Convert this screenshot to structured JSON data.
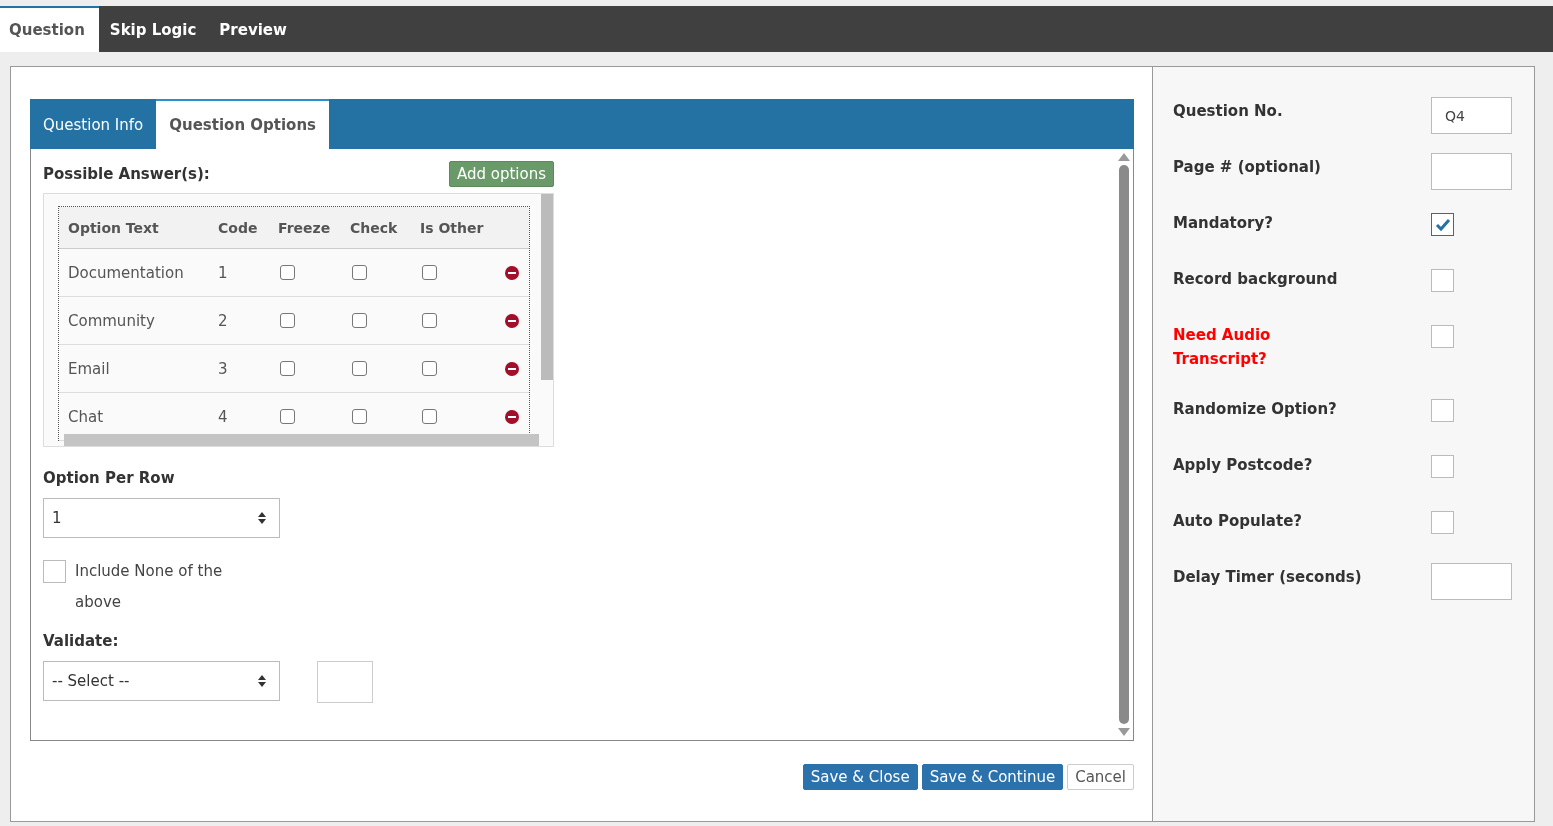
{
  "top_tabs": [
    {
      "label": "Question",
      "selected": true
    },
    {
      "label": "Skip Logic",
      "selected": false
    },
    {
      "label": "Preview",
      "selected": false
    }
  ],
  "inner_tabs": [
    {
      "label": "Question Info",
      "selected": false
    },
    {
      "label": "Question Options",
      "selected": true
    }
  ],
  "answers": {
    "title": "Possible Answer(s):",
    "add_button": "Add options",
    "columns": [
      "Option Text",
      "Code",
      "Freeze",
      "Check",
      "Is Other"
    ],
    "rows": [
      {
        "option_text": "Documentation",
        "code": "1",
        "freeze": false,
        "check": false,
        "is_other": false
      },
      {
        "option_text": "Community",
        "code": "2",
        "freeze": false,
        "check": false,
        "is_other": false
      },
      {
        "option_text": "Email",
        "code": "3",
        "freeze": false,
        "check": false,
        "is_other": false
      },
      {
        "option_text": "Chat",
        "code": "4",
        "freeze": false,
        "check": false,
        "is_other": false
      }
    ]
  },
  "option_per_row": {
    "label": "Option Per Row",
    "value": "1"
  },
  "include_none": {
    "label": "Include None of the above",
    "checked": false
  },
  "validate": {
    "label": "Validate:",
    "value": "-- Select --"
  },
  "buttons": [
    {
      "label": "Save & Close",
      "kind": "primary"
    },
    {
      "label": "Save & Continue",
      "kind": "primary"
    },
    {
      "label": "Cancel",
      "kind": "plain"
    }
  ],
  "settings": [
    {
      "kind": "text",
      "label": "Question No.",
      "value": "Q4",
      "alert": false
    },
    {
      "kind": "text",
      "label": "Page # (optional)",
      "alert": false
    },
    {
      "kind": "checkbox",
      "label": "Mandatory?",
      "checked": true,
      "alert": false
    },
    {
      "kind": "checkbox",
      "label": "Record background",
      "checked": false,
      "alert": false
    },
    {
      "kind": "checkbox",
      "label": "Need Audio Transcript?",
      "checked": false,
      "alert": true
    },
    {
      "kind": "checkbox",
      "label": "Randomize Option?",
      "checked": false,
      "alert": false
    },
    {
      "kind": "checkbox",
      "label": "Apply Postcode?",
      "checked": false,
      "alert": false
    },
    {
      "kind": "checkbox",
      "label": "Auto Populate?",
      "checked": false,
      "alert": false
    },
    {
      "kind": "text",
      "label": "Delay Timer (seconds)",
      "alert": false
    }
  ]
}
